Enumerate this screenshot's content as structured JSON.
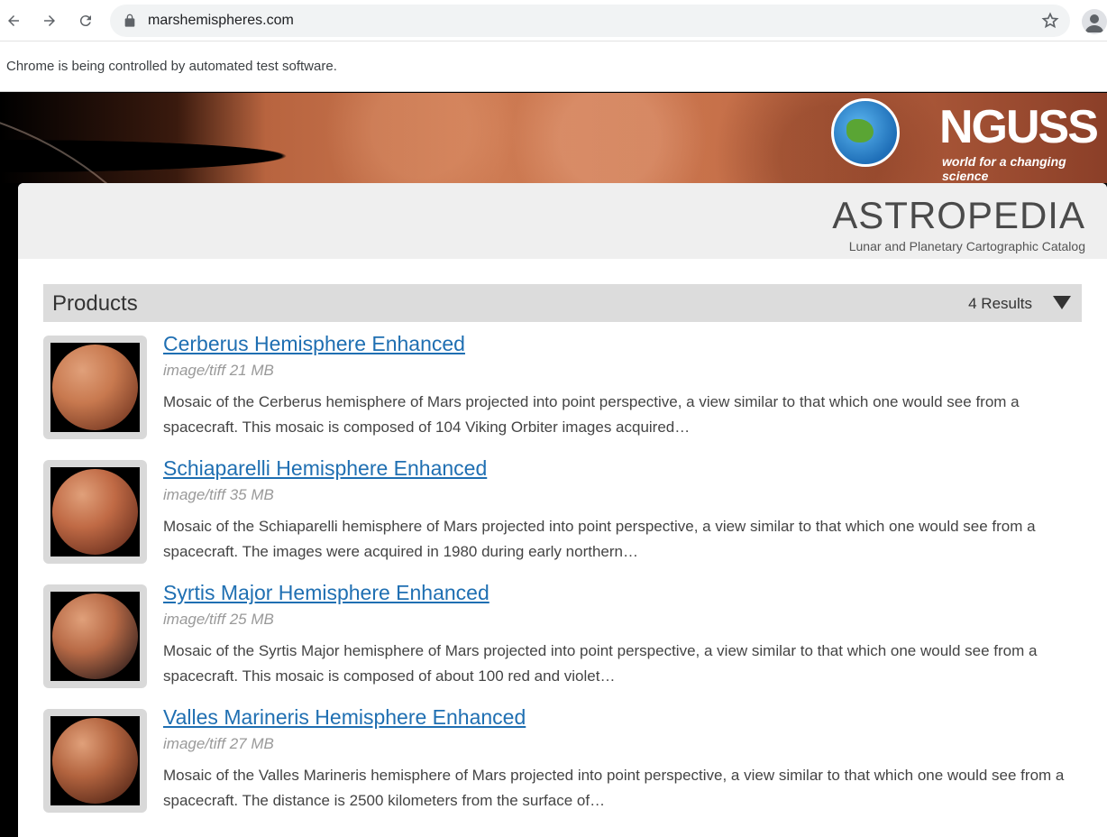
{
  "browser": {
    "url": "marshemispheres.com",
    "infobar": "Chrome is being controlled by automated test software."
  },
  "banner": {
    "logo_text": "NGUSS",
    "tagline": "world for a changing science"
  },
  "header": {
    "logo": "ASTROPEDIA",
    "subtitle": "Lunar and Planetary Cartographic Catalog"
  },
  "products": {
    "title": "Products",
    "results": "4 Results",
    "items": [
      {
        "title": "Cerberus Hemisphere Enhanced",
        "meta": "image/tiff 21 MB",
        "desc": "Mosaic of the Cerberus hemisphere of Mars projected into point perspective, a view similar to that which one would see from a spacecraft. This mosaic is composed of 104 Viking Orbiter images acquired…",
        "colors": [
          "#c8794f",
          "#7a3b24"
        ]
      },
      {
        "title": "Schiaparelli Hemisphere Enhanced",
        "meta": "image/tiff 35 MB",
        "desc": "Mosaic of the Schiaparelli hemisphere of Mars projected into point perspective, a view similar to that which one would see from a spacecraft. The images were acquired in 1980 during early northern…",
        "colors": [
          "#c06a45",
          "#6e3220"
        ]
      },
      {
        "title": "Syrtis Major Hemisphere Enhanced",
        "meta": "image/tiff 25 MB",
        "desc": "Mosaic of the Syrtis Major hemisphere of Mars projected into point perspective, a view similar to that which one would see from a spacecraft. This mosaic is composed of about 100 red and violet…",
        "colors": [
          "#b86a46",
          "#3a2420"
        ]
      },
      {
        "title": "Valles Marineris Hemisphere Enhanced",
        "meta": "image/tiff 27 MB",
        "desc": "Mosaic of the Valles Marineris hemisphere of Mars projected into point perspective, a view similar to that which one would see from a spacecraft. The distance is 2500 kilometers from the surface of…",
        "colors": [
          "#b3643f",
          "#5a2a1a"
        ]
      }
    ]
  }
}
